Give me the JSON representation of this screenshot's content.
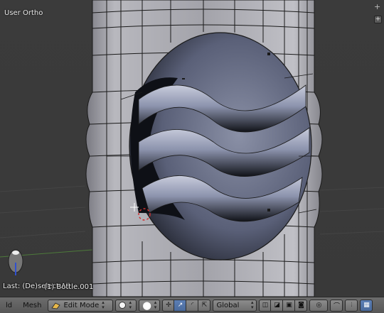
{
  "viewport": {
    "view_label": "User Ortho",
    "last_operator": "Last: (De)select All",
    "object_name": "(1) Bottle.001",
    "corner_plus": "+"
  },
  "header": {
    "view_menu": "ld",
    "mesh_menu": "Mesh",
    "mode": "Edit Mode",
    "transform_orientation": "Global"
  },
  "colors": {
    "mesh_face": "#a8a8b0",
    "wire": "#1a1a1a",
    "cavity_dark": "#1c1f28",
    "cavity_light": "#9ea4b8",
    "header_bg": "#626262",
    "active_button": "#5a7cb0"
  },
  "icons": [
    "viewport-shading-icon",
    "pivot-point-icon",
    "manipulator-icon",
    "translate-icon",
    "rotate-icon",
    "scale-icon",
    "vertex-select-icon",
    "edge-select-icon",
    "face-select-icon",
    "occlude-geometry-icon",
    "proportional-edit-icon",
    "snap-icon",
    "snap-element-icon"
  ]
}
